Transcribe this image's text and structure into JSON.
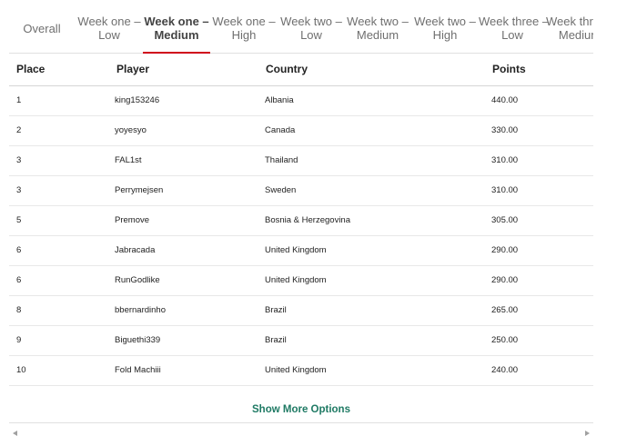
{
  "tabs": [
    {
      "line1": "Overall",
      "line2": ""
    },
    {
      "line1": "Week one –",
      "line2": "Low"
    },
    {
      "line1": "Week one –",
      "line2": "Medium"
    },
    {
      "line1": "Week one –",
      "line2": "High"
    },
    {
      "line1": "Week two –",
      "line2": "Low"
    },
    {
      "line1": "Week two –",
      "line2": "Medium"
    },
    {
      "line1": "Week two –",
      "line2": "High"
    },
    {
      "line1": "Week three –",
      "line2": "Low"
    },
    {
      "line1": "Week three –",
      "line2": "Medium"
    }
  ],
  "active_tab": "Week one – Medium",
  "accent_color": "#d0021b",
  "link_color": "#1f7a64",
  "table": {
    "headers": {
      "place": "Place",
      "player": "Player",
      "country": "Country",
      "points": "Points"
    },
    "rows": [
      {
        "place": "1",
        "player": "king153246",
        "country": "Albania",
        "points": "440.00"
      },
      {
        "place": "2",
        "player": "yoyesyo",
        "country": "Canada",
        "points": "330.00"
      },
      {
        "place": "3",
        "player": "FAL1st",
        "country": "Thailand",
        "points": "310.00"
      },
      {
        "place": "3",
        "player": "Perrymejsen",
        "country": "Sweden",
        "points": "310.00"
      },
      {
        "place": "5",
        "player": "Premove",
        "country": "Bosnia & Herzegovina",
        "points": "305.00"
      },
      {
        "place": "6",
        "player": "Jabracada",
        "country": "United Kingdom",
        "points": "290.00"
      },
      {
        "place": "6",
        "player": "RunGodlike",
        "country": "United Kingdom",
        "points": "290.00"
      },
      {
        "place": "8",
        "player": "bbernardinho",
        "country": "Brazil",
        "points": "265.00"
      },
      {
        "place": "9",
        "player": "Biguethi339",
        "country": "Brazil",
        "points": "250.00"
      },
      {
        "place": "10",
        "player": "Fold Machiii",
        "country": "United Kingdom",
        "points": "240.00"
      }
    ]
  },
  "show_more_label": "Show More Options"
}
